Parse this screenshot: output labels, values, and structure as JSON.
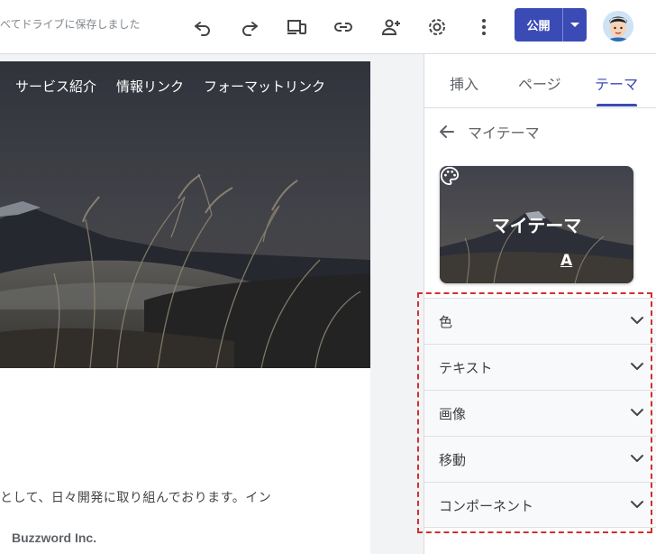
{
  "toolbar": {
    "save_status": "べてドライブに保存しました",
    "publish_label": "公開",
    "icons": [
      "undo-icon",
      "redo-icon",
      "preview-icon",
      "link-icon",
      "share-icon",
      "settings-icon",
      "more-icon",
      "chevron-down-icon"
    ]
  },
  "site": {
    "nav": [
      "サービス紹介",
      "情報リンク",
      "フォーマットリンク"
    ],
    "body_text": "として、日々開発に取り組んでおります。イン",
    "footer_text": "Buzzword Inc."
  },
  "panel": {
    "tabs": [
      {
        "label": "挿入",
        "active": false
      },
      {
        "label": "ページ",
        "active": false
      },
      {
        "label": "テーマ",
        "active": true
      }
    ],
    "back_label": "マイテーマ",
    "theme_card_title": "マイテーマ",
    "sections": [
      "色",
      "テキスト",
      "画像",
      "移動",
      "コンポーネント"
    ]
  },
  "colors": {
    "accent": "#3b4bb5",
    "highlight": "#d32f2f"
  }
}
